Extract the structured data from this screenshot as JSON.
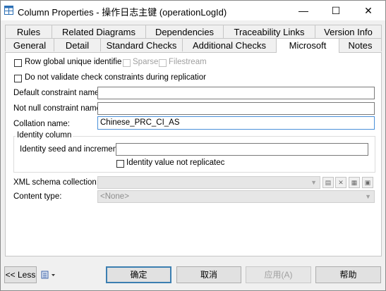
{
  "window": {
    "title": "Column Properties - 操作日志主键 (operationLogId)",
    "minimize_glyph": "—",
    "maximize_glyph": "☐",
    "close_glyph": "✕"
  },
  "tabs_row1": [
    "Rules",
    "Related Diagrams",
    "Dependencies",
    "Traceability Links",
    "Version Info"
  ],
  "tabs_row2": [
    "General",
    "Detail",
    "Standard Checks",
    "Additional Checks",
    "Microsoft",
    "Notes"
  ],
  "active_tab": "Microsoft",
  "microsoft": {
    "row_global_unique": {
      "label": "Row global unique identifie",
      "checked": false
    },
    "sparse": {
      "label": "Sparse",
      "checked": false,
      "enabled": false
    },
    "filestream": {
      "label": "Filestream",
      "checked": false,
      "enabled": false
    },
    "no_validate_checks": {
      "label": "Do not validate check constraints during replicatior",
      "checked": false
    },
    "default_constraint_name": {
      "label": "Default constraint name:",
      "value": ""
    },
    "not_null_constraint_name": {
      "label": "Not null constraint name:",
      "value": ""
    },
    "collation_name": {
      "label": "Collation name:",
      "value": "Chinese_PRC_CI_AS"
    },
    "identity_group": {
      "title": "Identity column",
      "seed_label": "Identity seed and increment:",
      "seed_value": "",
      "not_replicated": {
        "label": "Identity value not replicatec",
        "checked": false
      }
    },
    "xml_schema_collection": {
      "label": "XML schema collection:",
      "value": ""
    },
    "content_type": {
      "label": "Content type:",
      "value": "<None>"
    }
  },
  "footer": {
    "less_label": "<< Less",
    "ok_label": "确定",
    "cancel_label": "取消",
    "apply_label": "应用(A)",
    "help_label": "帮助"
  },
  "colors": {
    "focus_border": "#4a90d9",
    "default_button_border": "#3c7fb1"
  }
}
